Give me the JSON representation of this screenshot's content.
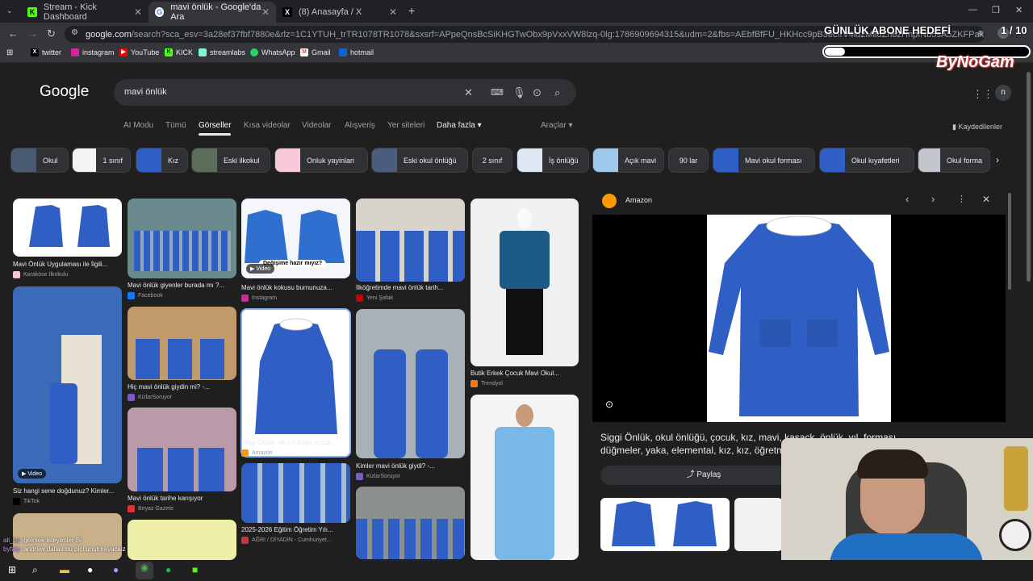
{
  "tabs": [
    {
      "title": "Stream - Kick Dashboard",
      "icon": "kick-icon"
    },
    {
      "title": "mavi önlük - Google'da Ara",
      "icon": "google-icon"
    },
    {
      "title": "(8) Anasayfa / X",
      "icon": "x-icon"
    }
  ],
  "url_host": "google.com",
  "url_rest": "/search?sca_esv=3a28ef37fbf7880e&rlz=1C1YTUH_trTR1078TR1078&sxsrf=APpeQnsBcSiKHGTwObx9pVxxVW8lzq-0lg:1786909694315&udm=2&fbs=AEbfBfFU_HKHcc9pB3ecIrV4ld2Mii8Zh8zHnpfNb5sA5ZKFPakNGwdyEBAAcxl",
  "bookmarks": [
    "twitter",
    "instagram",
    "YouTube",
    "KICK",
    "streamlabs",
    "WhatsApp",
    "Gmail",
    "hotmail"
  ],
  "search": {
    "query": "mavi önlük"
  },
  "logo": "Google",
  "nav_tabs": [
    "AI Modu",
    "Tümü",
    "Görseller",
    "Kısa videolar",
    "Videolar",
    "Alışveriş",
    "Yer siteleri",
    "Daha fazla",
    "Araçlar"
  ],
  "saved_label": "Kaydedilenler",
  "chips": [
    "Okul",
    "1 sınıf",
    "Kız",
    "Eski ilkokul",
    "Onluk yayinlari",
    "Eski okul önlüğü",
    "2 sınıf",
    "İş önlüğü",
    "Açık mavi",
    "90 lar",
    "Mavi okul forması",
    "Okul kıyafetleri",
    "Okul forma"
  ],
  "results": [
    {
      "caption": "Mavi Önlük Uygulaması ile İlgili...",
      "source": "Karaköse İlkokulu"
    },
    {
      "caption": "Mavi önlük giyenler burada mı ?...",
      "source": "Facebook"
    },
    {
      "caption": "Mavi önlük kokusu burnunuza...",
      "source": "Instagram",
      "badge": "Video",
      "overlay": "Değişime hazır mıyız?"
    },
    {
      "caption": "İlköğretimde mavi önlük tarih...",
      "source": "Yeni Şafak"
    },
    {
      "caption": "Butik Erkek Çocuk Mavi Okul...",
      "source": "Trendyol"
    },
    {
      "caption": "Hiç mavi önlük giydin mi? -...",
      "source": "KizlarSoruyor"
    },
    {
      "caption": "Siggi Önlük, okul önlüğü, çocuk,...",
      "source": "Amazon"
    },
    {
      "caption": "Kimler mavi önlük giydi? -...",
      "source": "KizlarSoruyor"
    },
    {
      "caption": "Siz hangi sene doğdunuz? Kimler...",
      "source": "TikTok",
      "badge": "Video"
    },
    {
      "caption": "Mavi önlük tarihe karışıyor",
      "source": "Beyaz Gazete"
    },
    {
      "caption": "2025-2026 Eğitim Öğretim Yılı...",
      "source": "AĞRI / DİYADİN - Cumhuriyet..."
    }
  ],
  "panel": {
    "source": "Amazon",
    "title": "Siggi Önlük, okul önlüğü, çocuk, kız, mavi, kasack, önlük, yıl, forması, düğmeler, yaka, elemental, kız, kız, öğretm",
    "share": "Paylaş"
  },
  "overlay": {
    "goal": "GÜNLÜK ABONE HEDEFİ",
    "count": "1 / 10",
    "progress": 0.1,
    "brand": "ByNoGam"
  },
  "chat": [
    {
      "user": "ali_by",
      "text": ": gelmek isteyenler Bi"
    },
    {
      "user": "byfaly",
      "text": ": andrew dallas bu pici unutmayacaiz"
    }
  ],
  "colors": {
    "uniform": "#2f5fc4",
    "uniform_dark": "#1e3f8f",
    "light_blue": "#79b8e6",
    "accent": "#e8eaed"
  }
}
